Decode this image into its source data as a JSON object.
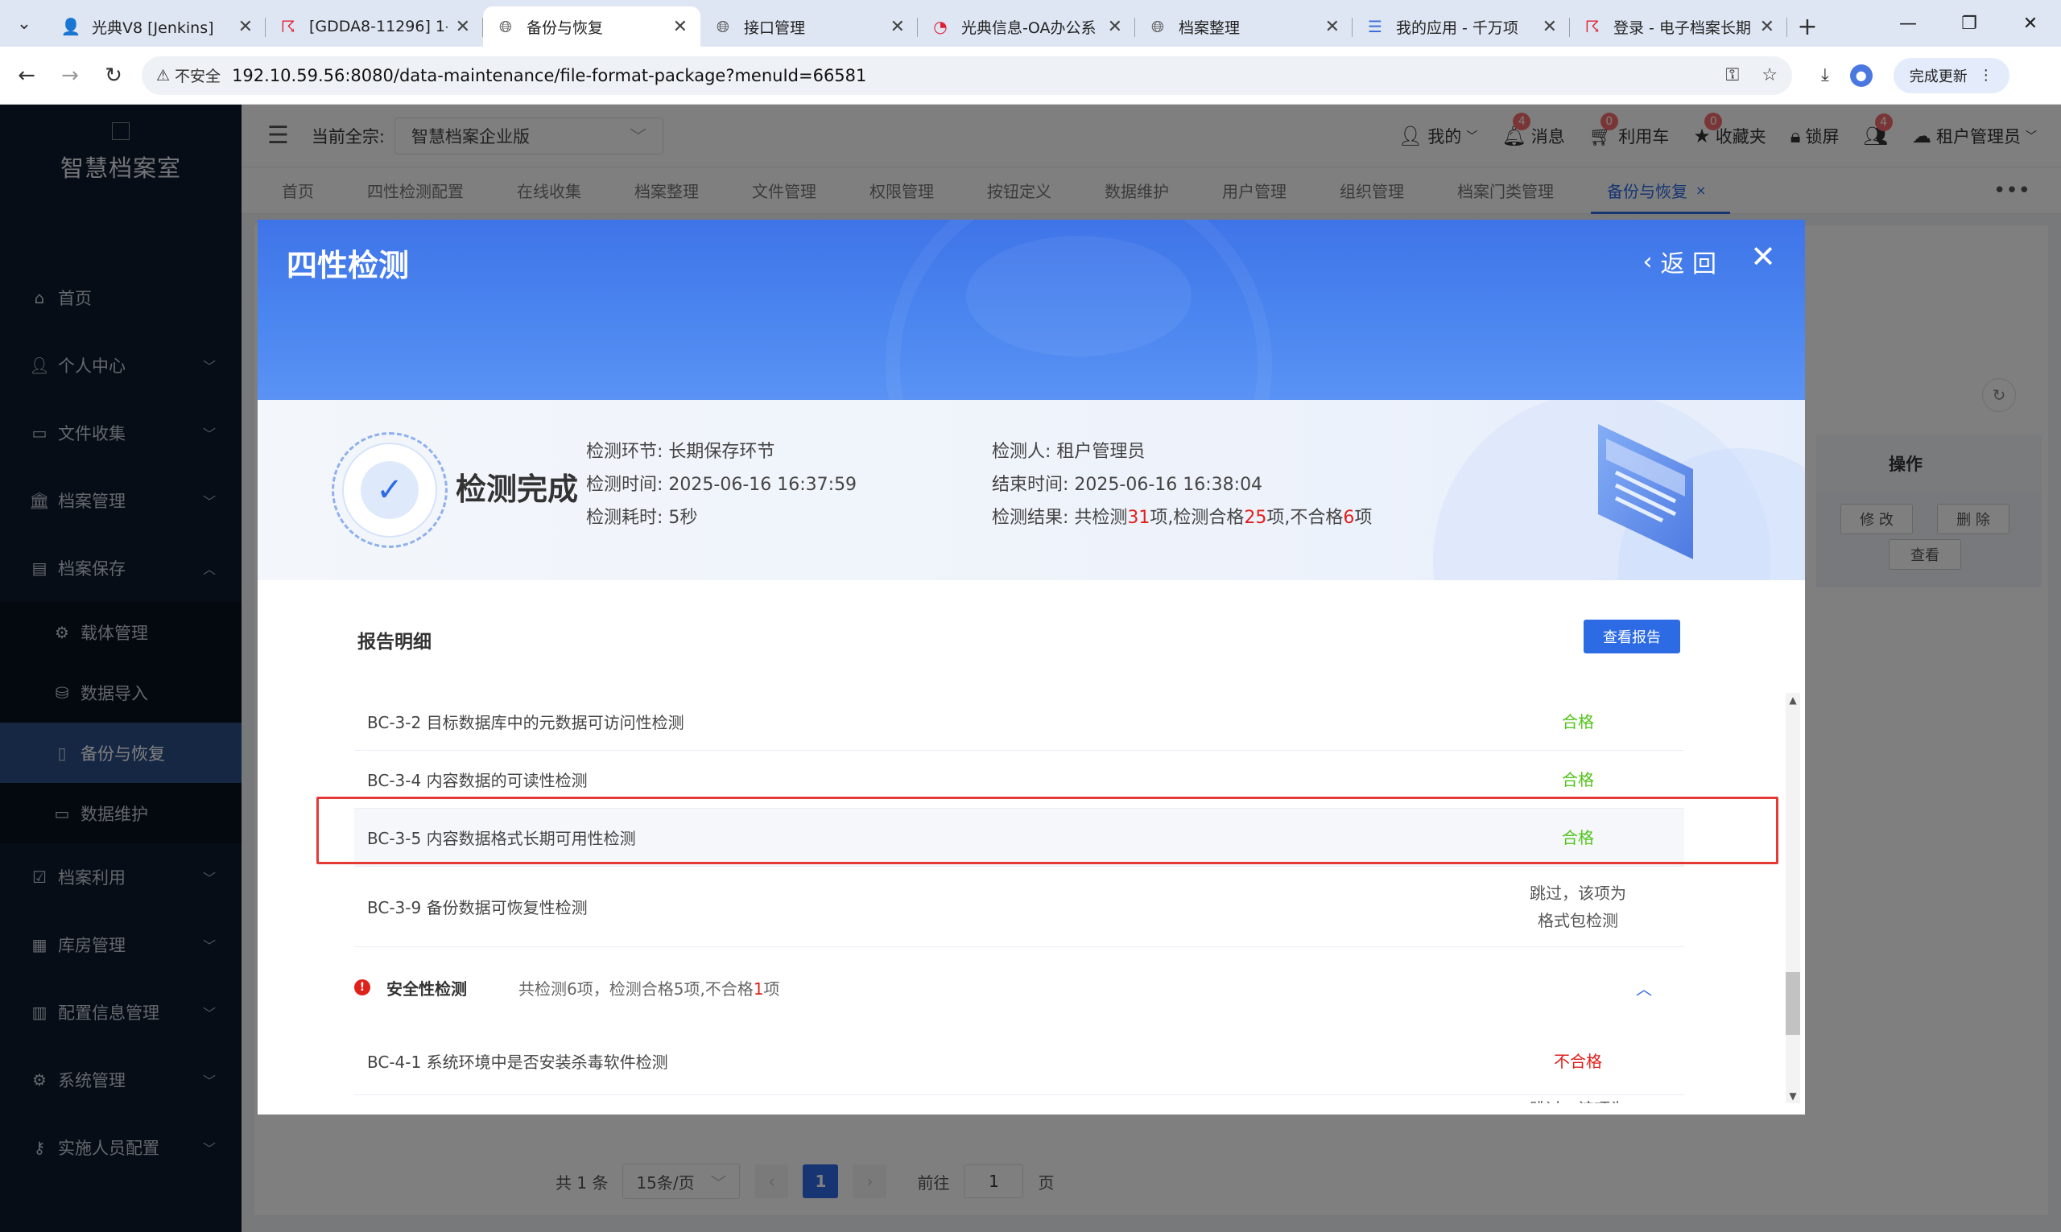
{
  "browser": {
    "tabs": [
      {
        "title": "光典V8 [Jenkins]",
        "icon": "jenkins-icon"
      },
      {
        "title": "[GDDA8-11296] 1-",
        "icon": "jira-icon"
      },
      {
        "title": "备份与恢复",
        "icon": "globe-icon"
      },
      {
        "title": "接口管理",
        "icon": "globe-icon"
      },
      {
        "title": "光典信息-OA办公系",
        "icon": "oa-icon"
      },
      {
        "title": "档案整理",
        "icon": "globe-icon"
      },
      {
        "title": "我的应用 - 千万项",
        "icon": "app-icon"
      },
      {
        "title": "登录 - 电子档案长期",
        "icon": "jira-icon"
      }
    ],
    "active_tab": 2,
    "insecure_label": "不安全",
    "url_host": "192.10.59.56",
    "url_path": ":8080/data-maintenance/file-format-package?menuId=66581",
    "update_label": "完成更新"
  },
  "sidebar": {
    "logo_text": "智慧档案室",
    "items": [
      {
        "label": "首页",
        "icon": "home-icon",
        "has_children": false
      },
      {
        "label": "个人中心",
        "icon": "user-icon",
        "has_children": true
      },
      {
        "label": "文件收集",
        "icon": "folder-icon",
        "has_children": true
      },
      {
        "label": "档案管理",
        "icon": "bank-icon",
        "has_children": true
      },
      {
        "label": "档案保存",
        "icon": "archive-icon",
        "has_children": true,
        "expanded": true
      }
    ],
    "submenu": [
      {
        "label": "载体管理",
        "icon": "chip-icon"
      },
      {
        "label": "数据导入",
        "icon": "import-icon"
      },
      {
        "label": "备份与恢复",
        "icon": "backup-icon",
        "active": true
      },
      {
        "label": "数据维护",
        "icon": "folder-outline-icon"
      }
    ],
    "items_after": [
      {
        "label": "档案利用",
        "icon": "use-icon"
      },
      {
        "label": "库房管理",
        "icon": "building-icon"
      },
      {
        "label": "配置信息管理",
        "icon": "config-icon"
      },
      {
        "label": "系统管理",
        "icon": "gear-icon"
      },
      {
        "label": "实施人员配置",
        "icon": "key-icon"
      }
    ]
  },
  "header": {
    "zong_label": "当前全宗:",
    "zong_value": "智慧档案企业版",
    "mine": "我的",
    "messages": "消息",
    "messages_count": "4",
    "cart": "利用车",
    "cart_count": "0",
    "favorites": "收藏夹",
    "favorites_count": "0",
    "lock": "锁屏",
    "users_count": "4",
    "tenant": "租户管理员"
  },
  "tags": [
    "首页",
    "四性检测配置",
    "在线收集",
    "档案整理",
    "文件管理",
    "权限管理",
    "按钮定义",
    "数据维护",
    "用户管理",
    "组织管理",
    "档案门类管理",
    "备份与恢复"
  ],
  "background": {
    "op_header": "操作",
    "edit": "修 改",
    "delete": "删 除",
    "view": "查看",
    "total": "共 1 条",
    "page_size": "15条/页",
    "current_page": "1",
    "goto_label": "前往",
    "goto_value": "1",
    "page_unit": "页"
  },
  "modal": {
    "title": "四性检测",
    "back": "返 回",
    "done_text": "检测完成",
    "stage": "检测环节: 长期保存环节",
    "start_time": "检测时间:   2025-06-16 16:37:59",
    "duration": "检测耗时:   5秒",
    "inspector": "检测人: 租户管理员",
    "end_time": "结束时间: 2025-06-16 16:38:04",
    "result_prefix": "检测结果:   共检测",
    "result_total": "31",
    "result_mid1": "项,检测合格",
    "result_pass": "25",
    "result_mid2": "项,不合格",
    "result_fail": "6",
    "result_suffix": "项",
    "report_heading": "报告明细",
    "view_report": "查看报告",
    "rows": [
      {
        "name": "BC-3-2 目标数据库中的元数据可访问性检测",
        "status": "合格",
        "type": "pass"
      },
      {
        "name": "BC-3-4 内容数据的可读性检测",
        "status": "合格",
        "type": "pass"
      },
      {
        "name": "BC-3-5 内容数据格式长期可用性检测",
        "status": "合格",
        "type": "pass"
      },
      {
        "name": "BC-3-9 备份数据可恢复性检测",
        "status_line1": "跳过，该项为",
        "status_line2": "格式包检测",
        "type": "skip"
      }
    ],
    "group": {
      "name": "安全性检测",
      "sum_prefix": "共检测6项，检测合格5项,不合格",
      "sum_fail": "1",
      "sum_suffix": "项"
    },
    "rows_after": [
      {
        "name": "BC-4-1 系统环境中是否安装杀毒软件检测",
        "status": "不合格",
        "type": "fail"
      },
      {
        "name": "",
        "status": "跳过，该项为",
        "type": "skip"
      }
    ]
  }
}
